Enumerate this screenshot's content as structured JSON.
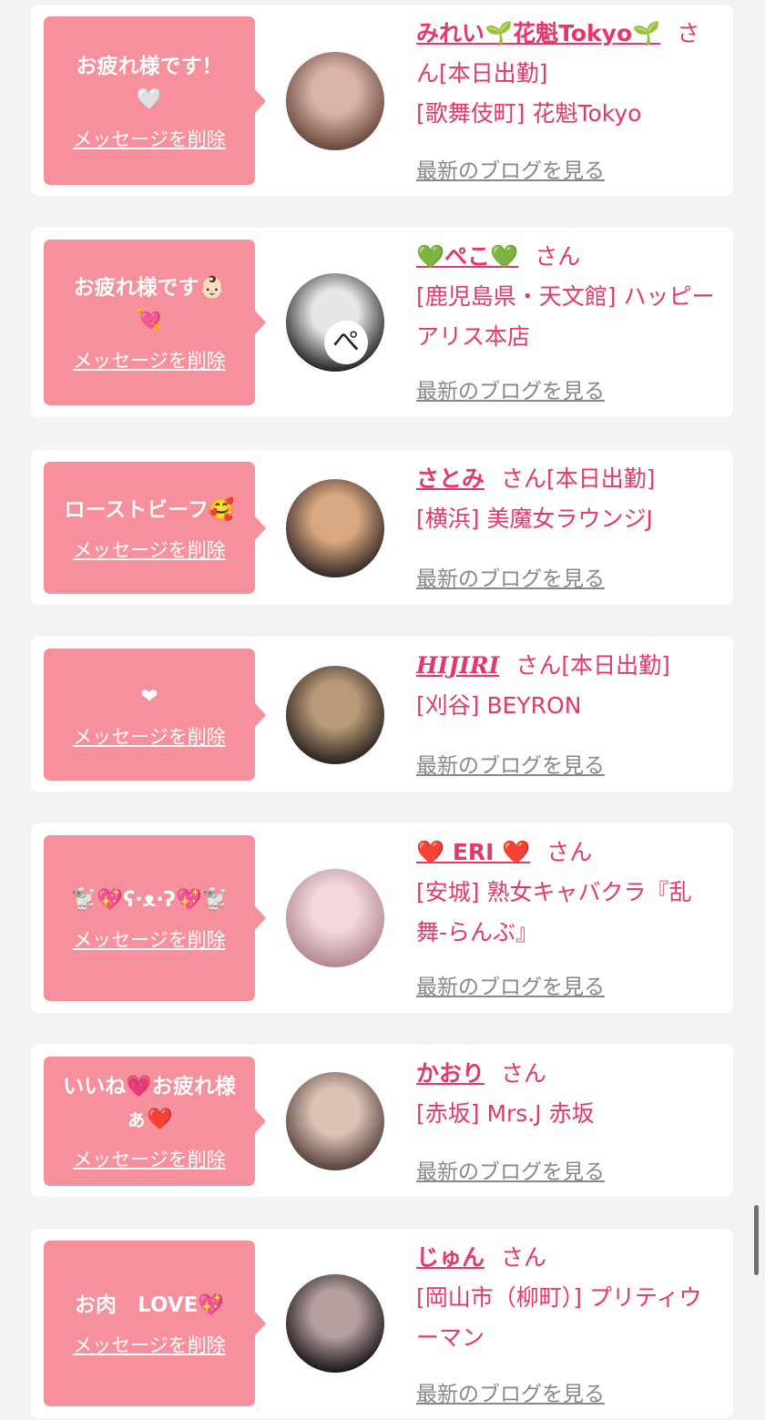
{
  "colors": {
    "background": "#f3f3f3",
    "card": "#ffffff",
    "bubble": "#f7909d",
    "accent": "#e2386a",
    "link_gray": "#888888"
  },
  "delete_label": "メッセージを削除",
  "blog_label": "最新のブログを見る",
  "suffix_label": "さん",
  "items": [
    {
      "message": [
        "お疲れ様です！",
        "🤍"
      ],
      "name": "みれい🌱花魁Tokyo🌱",
      "status": "[本日出勤]",
      "shop": "[歌舞伎町] 花魁Tokyo",
      "avatar_colors": [
        "#d9b3a6",
        "#6b4a3f"
      ],
      "avatar_label": ""
    },
    {
      "message": [
        "お疲れ様です👶🏻",
        "💘"
      ],
      "name": "💚ぺこ💚",
      "status": "",
      "shop": "[鹿児島県・天文館] ハッピーアリス本店",
      "avatar_colors": [
        "#e8e6e4",
        "#2a2a2a"
      ],
      "avatar_label": "ぺ"
    },
    {
      "message": [
        "ローストビーフ🥰"
      ],
      "name": "さとみ",
      "status": "[本日出勤]",
      "shop": "[横浜] 美魔女ラウンジJ",
      "avatar_colors": [
        "#d9a880",
        "#3a2a2a"
      ],
      "avatar_label": ""
    },
    {
      "message": [
        "❤"
      ],
      "name": "HIJIRI",
      "status": "[本日出勤]",
      "shop": "[刈谷] BEYRON",
      "avatar_colors": [
        "#b89a78",
        "#2e2620"
      ],
      "avatar_label": ""
    },
    {
      "message": [
        "🐩💖ʕ·ᴥ·ʔ💖🐩"
      ],
      "name": "❤️ ERI ❤️",
      "status": "",
      "shop": "[安城] 熟女キャバクラ『乱舞-らんぶ』",
      "avatar_colors": [
        "#f2d7dc",
        "#b58a92"
      ],
      "avatar_label": ""
    },
    {
      "message": [
        "いいね💗お疲れ様",
        "ぁ❤️"
      ],
      "name": "かおり",
      "status": "",
      "shop": "[赤坂] Mrs.J 赤坂",
      "avatar_colors": [
        "#dcc4b5",
        "#5a4540"
      ],
      "avatar_label": ""
    },
    {
      "message": [
        "お肉　LOVE💖"
      ],
      "name": "じゅん",
      "status": "",
      "shop": "[岡山市（柳町）] プリティウーマン",
      "avatar_colors": [
        "#b8a0a0",
        "#1f1a1d"
      ],
      "avatar_label": ""
    }
  ]
}
